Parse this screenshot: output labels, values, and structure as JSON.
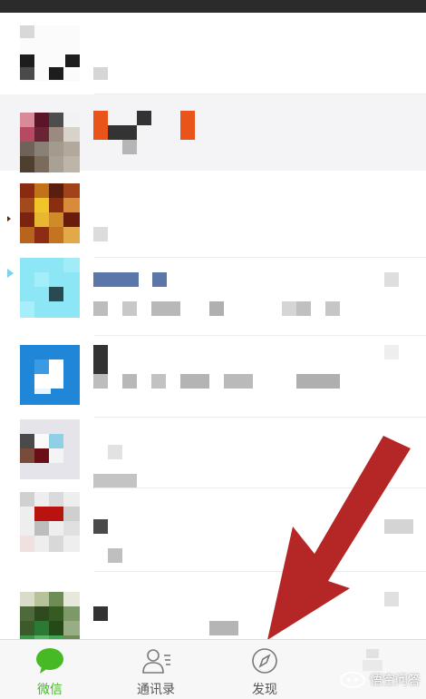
{
  "tabs": [
    {
      "label": "微信",
      "icon": "chat-bubble-icon",
      "active": true
    },
    {
      "label": "通讯录",
      "icon": "contacts-icon",
      "active": false
    },
    {
      "label": "发现",
      "icon": "compass-icon",
      "active": false
    },
    {
      "label": "",
      "icon": "me-icon",
      "active": false
    }
  ],
  "watermark": {
    "text": "悟空问答",
    "icon": "wukong-logo-icon"
  },
  "overlay": {
    "icon": "red-arrow-icon",
    "color": "#b52626"
  },
  "colors": {
    "accent": "#46b924",
    "status_bar": "#2b2b2b",
    "arrow": "#b52626"
  }
}
